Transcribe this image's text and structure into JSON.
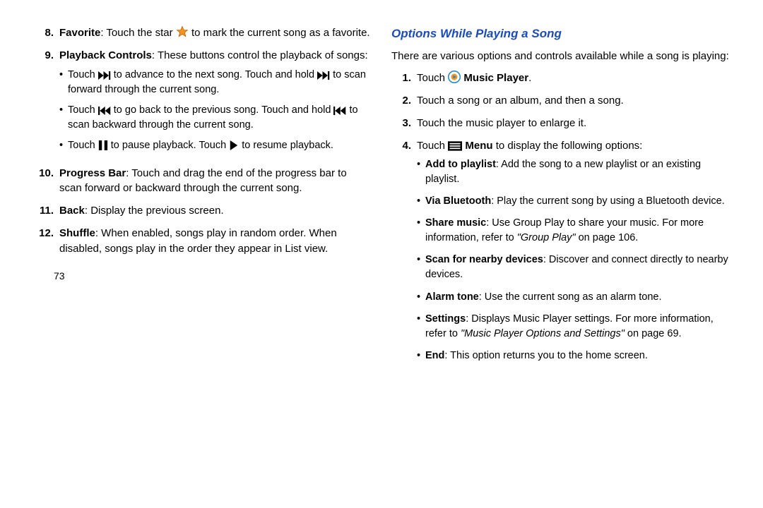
{
  "pageNumber": "73",
  "left": {
    "items": [
      {
        "num": "8.",
        "title": "Favorite",
        "pre": ": Touch the star ",
        "post": " to mark the current song as a favorite."
      },
      {
        "num": "9.",
        "title": "Playback Controls",
        "pre": ": These buttons control the playback of songs:",
        "bullets": [
          {
            "t1": "Touch ",
            "t2": " to advance to the next song. Touch and hold ",
            "t3": " to scan forward through the current song."
          },
          {
            "t1": "Touch ",
            "t2": " to go back to the previous song. Touch and hold ",
            "t3": " to scan backward through the current song."
          },
          {
            "t1": "Touch ",
            "t2": " to pause playback. Touch ",
            "t3": " to resume playback."
          }
        ]
      },
      {
        "num": "10.",
        "title": "Progress Bar",
        "pre": ": Touch and drag the end of the progress bar to scan forward or backward through the current song."
      },
      {
        "num": "11.",
        "title": "Back",
        "pre": ": Display the previous screen."
      },
      {
        "num": "12.",
        "title": "Shuffle",
        "pre": ": When enabled, songs play in random order. When disabled, songs play in the order they appear in List view."
      }
    ]
  },
  "right": {
    "heading": "Options While Playing a Song",
    "intro": "There are various options and controls available while a song is playing:",
    "steps": [
      {
        "num": "1.",
        "pre": "Touch ",
        "boldAfterIcon": "Music Player",
        "post": "."
      },
      {
        "num": "2.",
        "text": "Touch a song or an album, and then a song."
      },
      {
        "num": "3.",
        "text": "Touch the music player to enlarge it."
      },
      {
        "num": "4.",
        "pre": "Touch ",
        "boldAfterIcon": "Menu",
        "post": " to display the following options:"
      }
    ],
    "options": [
      {
        "title": "Add to playlist",
        "rest": ": Add the song to a new playlist or an existing playlist."
      },
      {
        "title": "Via Bluetooth",
        "rest": ": Play the current song by using a Bluetooth device."
      },
      {
        "title": "Share music",
        "restParts": [
          ": Use Group Play to share your music. For more information, refer to ",
          {
            "italic": "\"Group Play\""
          },
          " on page 106."
        ]
      },
      {
        "title": "Scan for nearby devices",
        "rest": ": Discover and connect directly to nearby devices."
      },
      {
        "title": "Alarm tone",
        "rest": ": Use the current song as an alarm tone."
      },
      {
        "title": "Settings",
        "restParts": [
          ": Displays Music Player settings. For more information, refer to ",
          {
            "italic": "\"Music Player Options and Settings\""
          },
          " on page 69."
        ]
      },
      {
        "title": "End",
        "rest": ": This option returns you to the home screen."
      }
    ]
  }
}
